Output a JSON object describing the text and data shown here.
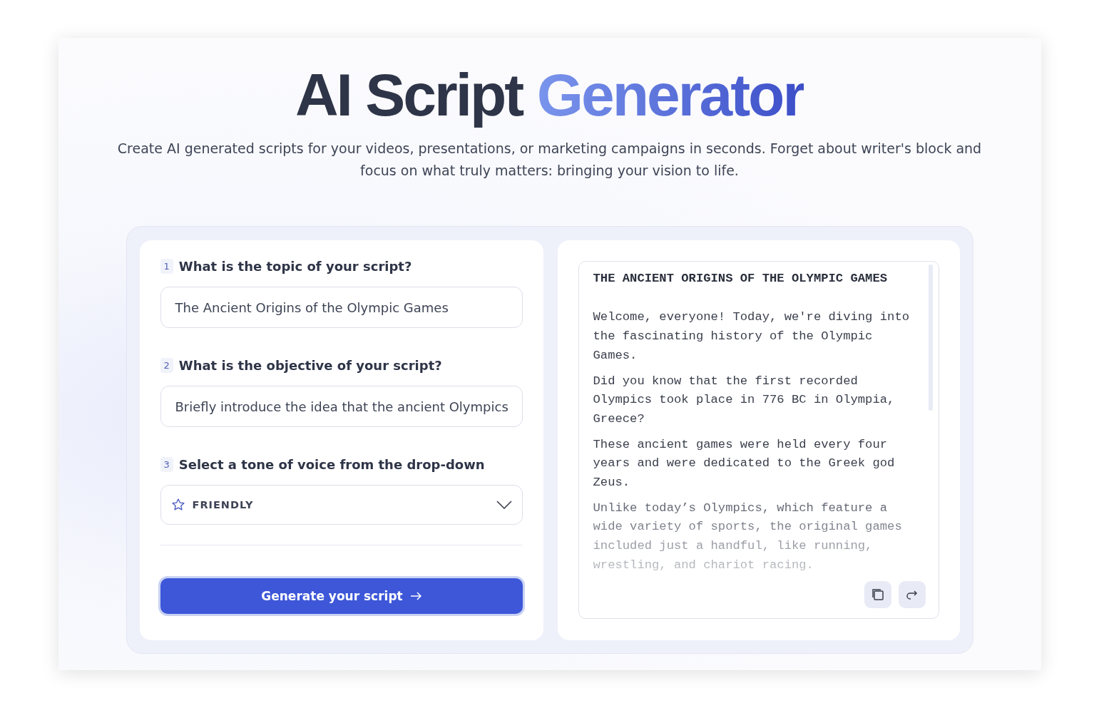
{
  "header": {
    "title": "AI Script",
    "title_accent": "Generator",
    "subtitle": "Create AI generated scripts for your videos, presentations, or marketing campaigns in seconds. Forget about writer's block and focus on what truly matters: bringing your vision to life."
  },
  "form": {
    "steps": [
      {
        "number": "1",
        "question": "What is the topic of your script?",
        "kind": "text",
        "value": "The Ancient Origins of the Olympic Games"
      },
      {
        "number": "2",
        "question": "What is the objective of your script?",
        "kind": "text",
        "value": "Briefly introduce the idea that the ancient Olympics"
      },
      {
        "number": "3",
        "question": "Select a tone of voice from the drop-down",
        "kind": "select",
        "value": "FRIENDLY"
      }
    ],
    "button": "Generate your script"
  },
  "output": {
    "heading": "THE ANCIENT ORIGINS OF THE OLYMPIC GAMES",
    "paragraphs": [
      {
        "text": "Welcome, everyone! Today, we're diving into the fascinating history of the Olympic Games.",
        "faded": false
      },
      {
        "text": "Did you know that the first recorded Olympics took place in 776 BC in Olympia, Greece?",
        "faded": false
      },
      {
        "text": "These ancient games were held every four years and were dedicated to the Greek god Zeus.",
        "faded": false
      },
      {
        "text": "Unlike today’s Olympics, which feature a wide variety of sports, the original games included just a handful, like running, wrestling, and chariot racing.",
        "faded": true
      }
    ],
    "actions": [
      {
        "kind": "copy"
      },
      {
        "kind": "share"
      }
    ]
  }
}
